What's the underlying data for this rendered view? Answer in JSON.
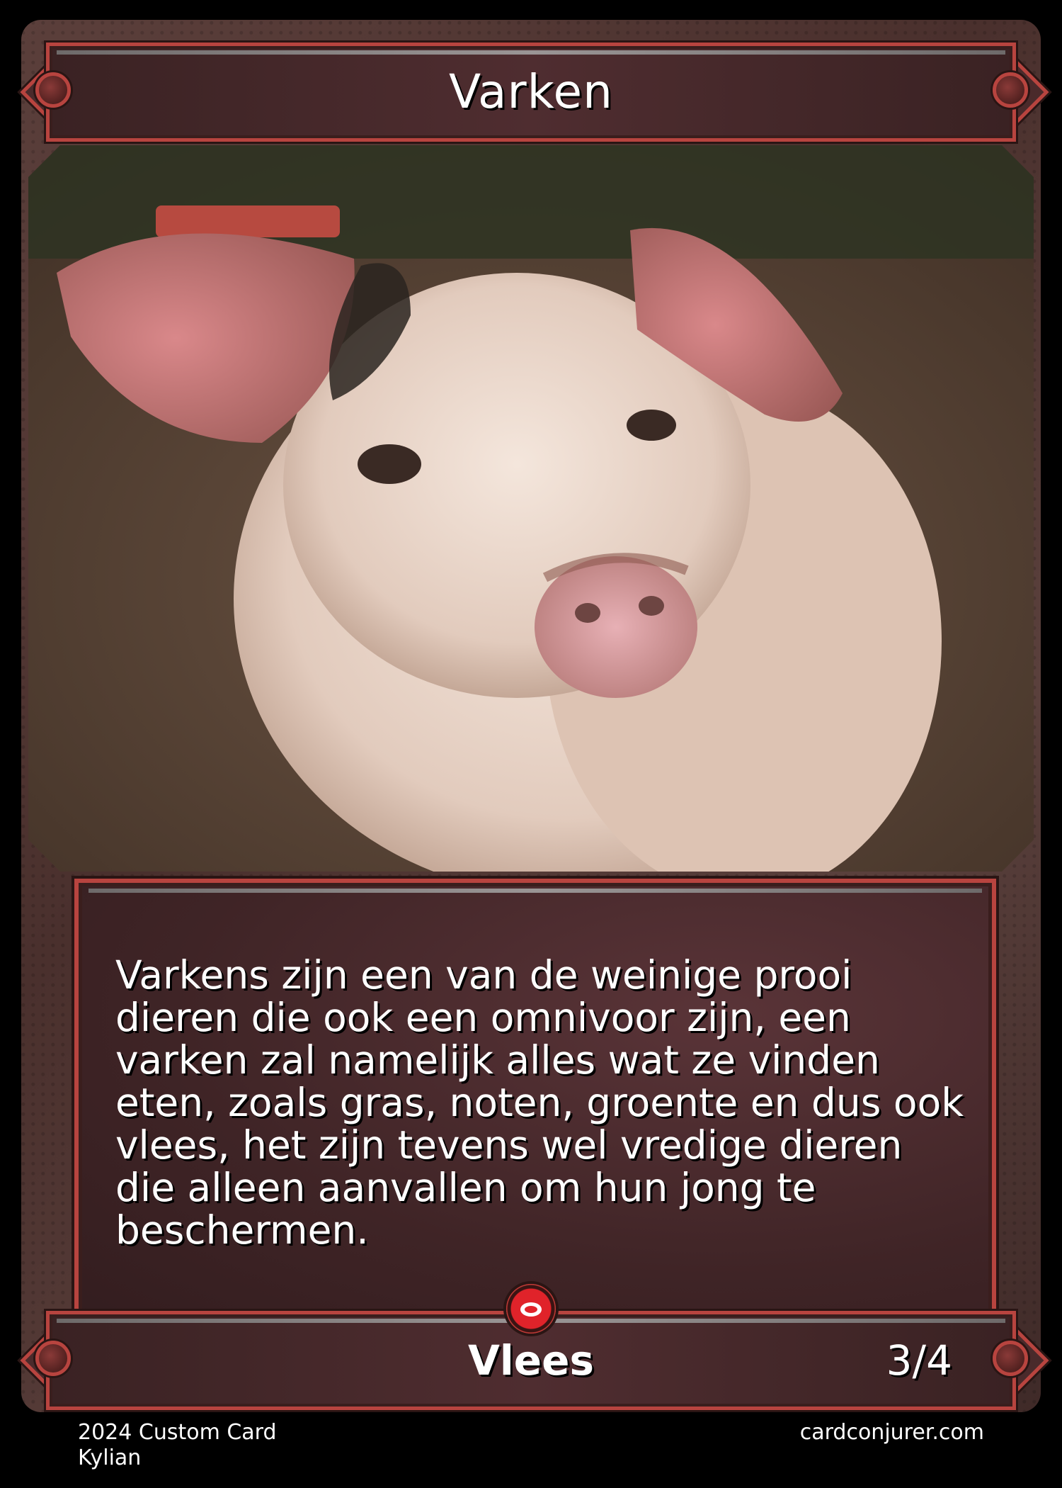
{
  "card": {
    "name": "Varken",
    "flavor_text": "Varkens zijn een van de weinige prooi dieren die ook een omnivoor zijn, een varken zal namelijk alles wat ze vinden eten, zoals gras, noten, groente en dus ook vlees, het zijn tevens wel vredige dieren die alleen aanvallen om hun jong te beschermen.",
    "type": "Vlees",
    "power_toughness": "3/4",
    "art_subject": "pig",
    "set_icon": "meat-icon"
  },
  "footer": {
    "left_line1": "2024 Custom Card",
    "left_line2": "Kylian",
    "right": "cardconjurer.com"
  },
  "colors": {
    "frame_red": "#b8443f",
    "bar_dark": "#3a2223",
    "gem_red": "#e0232a"
  }
}
